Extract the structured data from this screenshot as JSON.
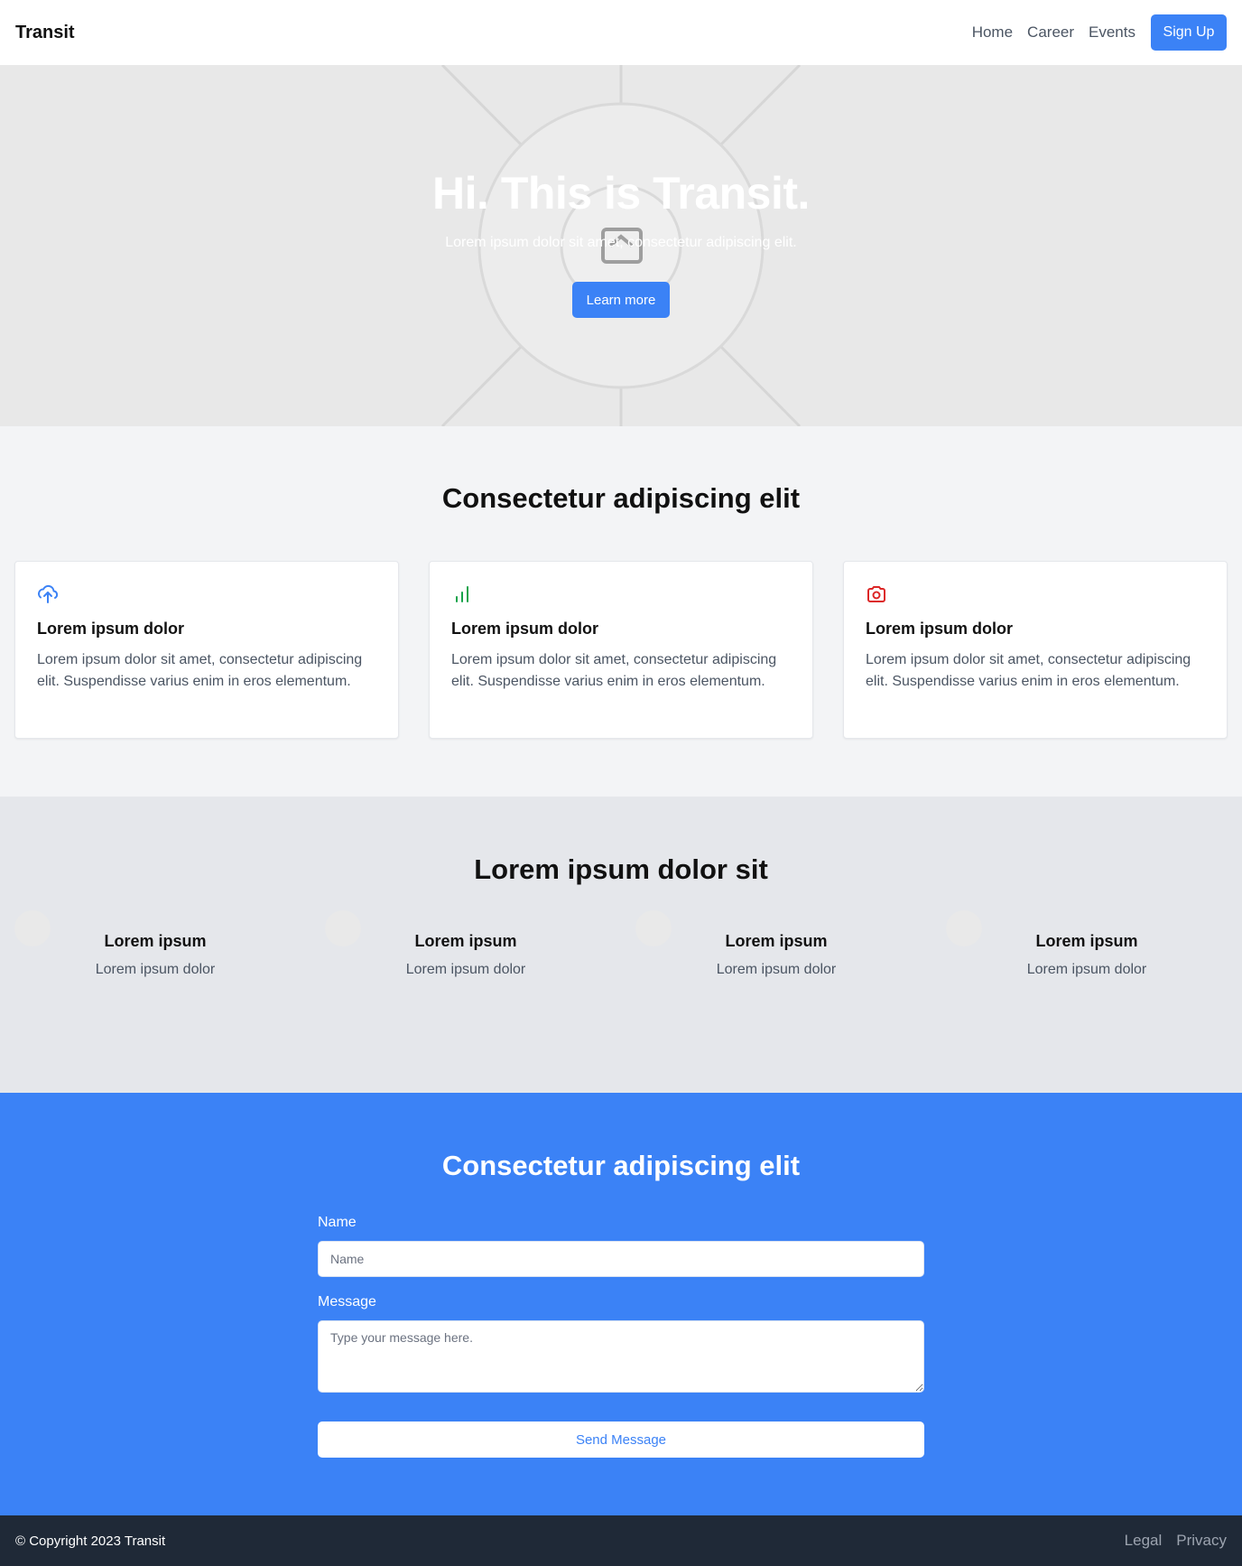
{
  "nav": {
    "brand": "Transit",
    "links": [
      "Home",
      "Career",
      "Events"
    ],
    "cta": "Sign Up"
  },
  "hero": {
    "title": "Hi. This is Transit.",
    "subtitle": "Lorem ipsum dolor sit amet, consectetur adipiscing elit.",
    "button": "Learn more",
    "icon": "image-placeholder-icon"
  },
  "features": {
    "title": "Consectetur adipiscing elit",
    "cards": [
      {
        "icon": "cloud-upload-icon",
        "icon_color": "#3b82f6",
        "title": "Lorem ipsum dolor",
        "text": "Lorem ipsum dolor sit amet, consectetur adipiscing elit. Suspendisse varius enim in eros elementum."
      },
      {
        "icon": "bar-chart-icon",
        "icon_color": "#16a34a",
        "title": "Lorem ipsum dolor",
        "text": "Lorem ipsum dolor sit amet, consectetur adipiscing elit. Suspendisse varius enim in eros elementum."
      },
      {
        "icon": "camera-icon",
        "icon_color": "#dc2626",
        "title": "Lorem ipsum dolor",
        "text": "Lorem ipsum dolor sit amet, consectetur adipiscing elit. Suspendisse varius enim in eros elementum."
      }
    ]
  },
  "stats": {
    "title": "Lorem ipsum dolor sit",
    "items": [
      {
        "title": "Lorem ipsum",
        "text": "Lorem ipsum dolor"
      },
      {
        "title": "Lorem ipsum",
        "text": "Lorem ipsum dolor"
      },
      {
        "title": "Lorem ipsum",
        "text": "Lorem ipsum dolor"
      },
      {
        "title": "Lorem ipsum",
        "text": "Lorem ipsum dolor"
      }
    ]
  },
  "contact": {
    "title": "Consectetur adipiscing elit",
    "name_label": "Name",
    "name_placeholder": "Name",
    "message_label": "Message",
    "message_placeholder": "Type your message here.",
    "submit": "Send Message"
  },
  "footer": {
    "copyright": "© Copyright 2023 Transit",
    "links": [
      "Legal",
      "Privacy"
    ]
  },
  "colors": {
    "primary": "#3b82f6",
    "footer_bg": "#1f2937"
  }
}
